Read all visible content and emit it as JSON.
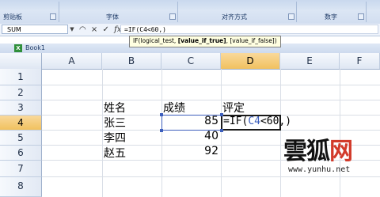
{
  "ribbon": {
    "groups": [
      "剪贴板",
      "字体",
      "对齐方式",
      "数字"
    ]
  },
  "formula_bar": {
    "namebox": "SUM",
    "icons": [
      "×",
      "✓",
      "fx"
    ],
    "formula": "=IF(C4<60,)"
  },
  "tooltip": {
    "prefix": "IF(logical_test, ",
    "bold": "[value_if_true]",
    "suffix": ", [value_if_false])"
  },
  "document": {
    "title": "Book1"
  },
  "columns": [
    "A",
    "B",
    "C",
    "D",
    "E",
    "F"
  ],
  "rows": [
    "1",
    "2",
    "3",
    "4",
    "5",
    "6",
    "7",
    "8"
  ],
  "cells": {
    "B3": "姓名",
    "C3": "成绩",
    "D3": "评定",
    "B4": "张三",
    "C4": "85",
    "B5": "李四",
    "C5": "40",
    "B6": "赵五",
    "C6": "92"
  },
  "editing": {
    "prefix": "=IF(",
    "ref": "C4",
    "suffix": "<60,)"
  },
  "watermark": {
    "brand": "雲狐网",
    "brand_black": "雲狐",
    "brand_red": "网",
    "url": "www.yunhu.net"
  },
  "colors": {
    "active_header": "#f1c15f",
    "ref_blue": "#3d5fbd",
    "watermark_red": "#d23a2a"
  }
}
